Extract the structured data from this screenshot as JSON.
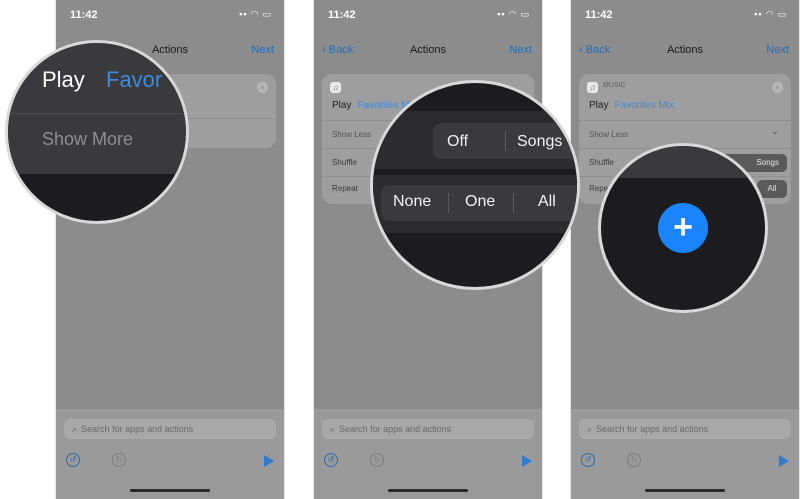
{
  "status": {
    "time": "11:42",
    "icons": "▪▪ ◠ ▭"
  },
  "nav": {
    "back": "Back",
    "title": "Actions",
    "next": "Next"
  },
  "card": {
    "app_header": "MUSIC",
    "play_label": "Play",
    "playlist": "Favorites Mix",
    "show_more": "Show More",
    "show_less": "Show Less",
    "shuffle": "Shuffle",
    "repeat": "Repeat"
  },
  "bottom": {
    "search_placeholder": "Search for apps and actions"
  },
  "zoom1": {
    "play": "Play",
    "favorites": "Favor",
    "show_more": "Show More"
  },
  "zoom2": {
    "off": "Off",
    "songs": "Songs",
    "none": "None",
    "one": "One",
    "all": "All"
  },
  "zoom3": {
    "plus": "+"
  },
  "panel3": {
    "songs": "Songs",
    "all": "All"
  },
  "colors": {
    "accent": "#1a84ff",
    "link": "#3d8ae0"
  }
}
